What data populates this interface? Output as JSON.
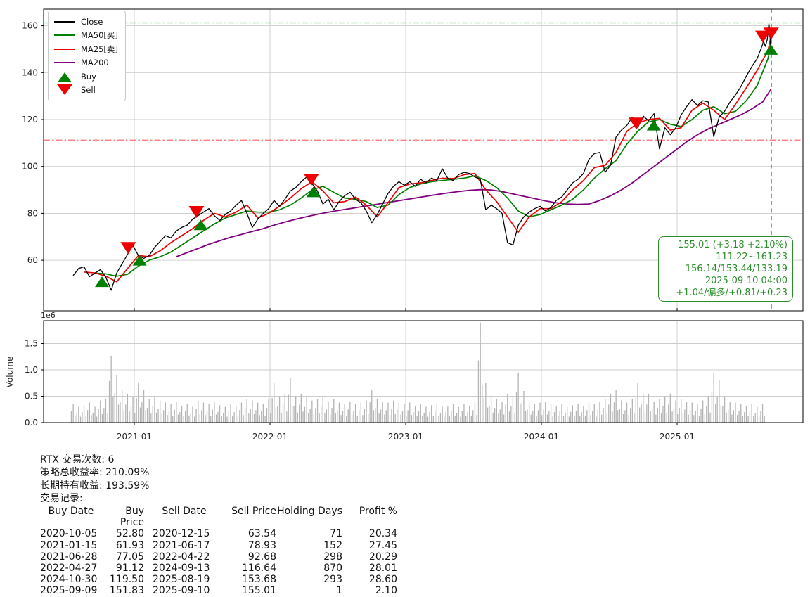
{
  "colors": {
    "close": "#000000",
    "ma25": "#f00000",
    "ma50": "#008000",
    "ma200": "#800080",
    "buy_marker": "#008000",
    "sell_marker": "#ee0000",
    "range_high_line": "#00a000",
    "range_low_line": "#ff5555",
    "vline": "#2aa02a",
    "annotation": "#2a8f2a",
    "grid": "#cccccc",
    "volume_bar": "#b4b4b4",
    "tick_text": "#222222"
  },
  "legend": {
    "items": [
      {
        "label": "Close",
        "swatch": "line",
        "color": "#000000"
      },
      {
        "label": "MA50[买]",
        "swatch": "line",
        "color": "#008000"
      },
      {
        "label": "MA25[卖]",
        "swatch": "line",
        "color": "#f00000"
      },
      {
        "label": "MA200",
        "swatch": "line",
        "color": "#800080"
      },
      {
        "label": "Buy",
        "swatch": "triangle-up",
        "color": "#008000"
      },
      {
        "label": "Sell",
        "swatch": "triangle-down",
        "color": "#f00000"
      }
    ]
  },
  "annotation": {
    "lines": [
      "155.01 (+3.18 +2.10%)",
      "111.22~161.23",
      "156.14/153.44/133.19",
      "2025-09-10 04:00",
      "+1.04/偏多/+0.81/+0.23"
    ]
  },
  "summary": {
    "lines": [
      "RTX 交易次数: 6",
      "策略总收益率: 210.09%",
      "长期持有收益: 193.59%",
      "交易记录:"
    ]
  },
  "trade_table": {
    "headers": [
      "Buy Date",
      "Buy Price",
      "Sell Date",
      "Sell Price",
      "Holding Days",
      "Profit %"
    ],
    "rows": [
      [
        "2020-10-05",
        "52.80",
        "2020-12-15",
        "63.54",
        "71",
        "20.34"
      ],
      [
        "2021-01-15",
        "61.93",
        "2021-06-17",
        "78.93",
        "152",
        "27.45"
      ],
      [
        "2021-06-28",
        "77.05",
        "2022-04-22",
        "92.68",
        "298",
        "20.29"
      ],
      [
        "2022-04-27",
        "91.12",
        "2024-09-13",
        "116.64",
        "870",
        "28.01"
      ],
      [
        "2024-10-30",
        "119.50",
        "2025-08-19",
        "153.68",
        "293",
        "28.60"
      ],
      [
        "2025-09-09",
        "151.83",
        "2025-09-10",
        "155.01",
        "1",
        "2.10"
      ]
    ]
  },
  "chart_data": {
    "type": "line",
    "title": "",
    "xlabel": "",
    "ylabel_volume": "Volume",
    "volume_multiplier_label": "1e6",
    "x_axis": {
      "ticks": [
        {
          "t": 2021.0,
          "label": "2021-01"
        },
        {
          "t": 2022.0,
          "label": "2022-01"
        },
        {
          "t": 2023.0,
          "label": "2023-01"
        },
        {
          "t": 2024.0,
          "label": "2024-01"
        },
        {
          "t": 2025.0,
          "label": "2025-01"
        }
      ],
      "xlim": [
        2020.33,
        2025.92
      ]
    },
    "price_axis": {
      "ticks": [
        60,
        80,
        100,
        120,
        140,
        160
      ],
      "ylim": [
        38.5,
        166.5
      ],
      "range_high": 161.23,
      "range_low": 111.22,
      "last_date_t": 2025.695,
      "grid": true
    },
    "volume_axis": {
      "ticks": [
        0.0,
        0.5,
        1.0,
        1.5
      ],
      "ymax": 1.93,
      "grid": true
    },
    "series": {
      "close": {
        "x0": 2020.55,
        "dx": 0.04,
        "values": [
          53.5,
          56.5,
          57.2,
          53.0,
          54.5,
          56.0,
          52.8,
          47.2,
          54.5,
          58.5,
          62.5,
          66.3,
          62.0,
          60.8,
          62.0,
          65.5,
          68.0,
          70.5,
          69.5,
          72.5,
          74.0,
          75.0,
          77.5,
          79.0,
          80.5,
          82.0,
          79.0,
          77.0,
          79.5,
          81.0,
          83.5,
          85.5,
          80.0,
          74.0,
          77.5,
          80.0,
          82.0,
          85.5,
          83.0,
          86.0,
          89.5,
          91.0,
          93.5,
          95.5,
          92.7,
          89.5,
          84.0,
          86.0,
          81.5,
          85.0,
          87.5,
          89.0,
          86.0,
          84.5,
          81.0,
          76.0,
          79.5,
          84.0,
          88.5,
          91.5,
          93.5,
          92.0,
          93.5,
          91.5,
          94.5,
          93.0,
          95.0,
          94.0,
          99.0,
          95.0,
          94.0,
          96.5,
          97.5,
          97.0,
          95.5,
          94.5,
          81.5,
          83.5,
          82.0,
          80.0,
          67.5,
          66.5,
          75.0,
          78.5,
          80.5,
          82.0,
          83.0,
          81.0,
          82.5,
          85.5,
          87.0,
          90.0,
          93.0,
          94.5,
          97.0,
          103.0,
          105.5,
          106.0,
          97.5,
          100.5,
          112.5,
          115.5,
          117.5,
          121.0,
          116.6,
          121.5,
          119.5,
          122.5,
          107.5,
          116.5,
          113.5,
          116.5,
          122.0,
          125.5,
          128.5,
          126.0,
          128.0,
          127.5,
          112.7,
          121.0,
          123.5,
          127.5,
          130.5,
          134.0,
          138.5,
          142.5,
          146.0,
          152.0
        ],
        "tail": [
          [
            2025.636,
            153.68
          ],
          [
            2025.65,
            151.2
          ],
          [
            2025.664,
            154.0
          ],
          [
            2025.676,
            160.9
          ],
          [
            2025.682,
            158.5
          ],
          [
            2025.688,
            151.83
          ],
          [
            2025.695,
            155.01
          ]
        ]
      },
      "ma25": {
        "x0": 2020.63,
        "dx": 0.08,
        "values": [
          55.0,
          54.6,
          53.2,
          50.8,
          56.5,
          62.0,
          61.5,
          64.0,
          67.5,
          70.5,
          73.5,
          77.0,
          80.0,
          78.5,
          80.5,
          83.5,
          78.0,
          80.0,
          83.0,
          86.5,
          90.5,
          93.5,
          89.5,
          84.5,
          85.0,
          87.0,
          83.5,
          78.5,
          84.5,
          91.0,
          92.5,
          93.0,
          94.0,
          95.0,
          94.8,
          96.5,
          97.0,
          90.0,
          85.0,
          78.5,
          72.0,
          78.5,
          82.0,
          82.0,
          85.0,
          90.0,
          94.0,
          99.5,
          100.5,
          106.0,
          115.0,
          118.5,
          120.0,
          120.5,
          115.5,
          116.5,
          124.0,
          127.0,
          124.0,
          120.0,
          126.5,
          133.5,
          141.0,
          149.5
        ],
        "tail": [
          [
            2025.695,
            156.14
          ]
        ]
      },
      "ma50": {
        "x0": 2020.71,
        "dx": 0.08,
        "values": [
          54.5,
          54.2,
          53.2,
          54.0,
          57.5,
          60.0,
          61.5,
          63.5,
          66.5,
          69.5,
          72.5,
          75.5,
          78.0,
          79.5,
          81.0,
          80.5,
          80.5,
          81.5,
          83.5,
          86.5,
          90.0,
          91.5,
          89.0,
          86.5,
          86.0,
          85.0,
          82.5,
          83.5,
          88.0,
          91.0,
          92.5,
          93.5,
          94.0,
          94.5,
          95.0,
          96.0,
          94.0,
          91.0,
          86.5,
          81.0,
          78.5,
          79.5,
          81.5,
          83.5,
          86.0,
          90.0,
          95.0,
          99.0,
          102.5,
          109.5,
          115.0,
          119.0,
          120.0,
          118.0,
          117.0,
          120.0,
          124.0,
          125.5,
          122.5,
          123.5,
          128.0,
          134.5,
          146.0
        ],
        "tail": [
          [
            2025.695,
            153.44
          ]
        ]
      },
      "ma200": {
        "x0": 2021.31,
        "dx": 0.08,
        "values": [
          61.5,
          63.3,
          65.0,
          66.8,
          68.3,
          69.8,
          71.0,
          72.3,
          73.5,
          75.0,
          76.3,
          77.5,
          78.6,
          79.6,
          80.5,
          81.3,
          82.0,
          82.8,
          83.5,
          84.3,
          85.0,
          85.8,
          86.5,
          87.3,
          88.0,
          88.7,
          89.3,
          89.8,
          90.1,
          90.0,
          89.3,
          88.3,
          87.3,
          86.3,
          85.3,
          84.5,
          84.0,
          83.8,
          84.0,
          85.5,
          87.5,
          90.0,
          93.0,
          96.5,
          100.0,
          103.5,
          107.0,
          110.5,
          113.5,
          116.0,
          118.0,
          120.0,
          122.0,
          124.5,
          127.5
        ],
        "tail": [
          [
            2025.695,
            133.19
          ]
        ]
      },
      "volume": {
        "x0": 2020.55,
        "dx": 0.04,
        "values": [
          0.35,
          0.3,
          0.32,
          0.38,
          0.3,
          0.42,
          0.45,
          1.27,
          0.9,
          0.62,
          0.55,
          0.48,
          0.75,
          0.62,
          0.45,
          0.5,
          0.42,
          0.38,
          0.35,
          0.4,
          0.32,
          0.36,
          0.3,
          0.42,
          0.38,
          0.35,
          0.4,
          0.33,
          0.3,
          0.35,
          0.32,
          0.38,
          0.45,
          0.42,
          0.38,
          0.35,
          0.45,
          0.75,
          0.5,
          0.55,
          0.85,
          0.5,
          0.55,
          0.48,
          0.42,
          0.45,
          0.5,
          0.4,
          0.45,
          0.38,
          0.35,
          0.4,
          0.35,
          0.38,
          0.42,
          0.62,
          0.45,
          0.4,
          0.38,
          0.42,
          0.4,
          0.35,
          0.38,
          0.32,
          0.35,
          0.3,
          0.33,
          0.35,
          0.3,
          0.32,
          0.35,
          0.3,
          0.35,
          0.32,
          0.38,
          1.9,
          0.75,
          0.5,
          0.45,
          0.4,
          0.55,
          0.5,
          0.95,
          0.6,
          0.4,
          0.35,
          0.38,
          0.4,
          0.35,
          0.32,
          0.35,
          0.3,
          0.33,
          0.35,
          0.32,
          0.38,
          0.35,
          0.4,
          0.45,
          0.55,
          0.62,
          0.42,
          0.38,
          0.45,
          0.75,
          0.55,
          0.55,
          0.4,
          0.45,
          0.5,
          0.55,
          0.42,
          0.45,
          0.4,
          0.38,
          0.35,
          0.42,
          0.5,
          0.95,
          0.8,
          0.5,
          0.4,
          0.38,
          0.35,
          0.32,
          0.35,
          0.3,
          0.35
        ]
      }
    },
    "markers": {
      "buys": [
        {
          "t": 2020.762,
          "price": 52.8
        },
        {
          "t": 2021.04,
          "price": 61.93
        },
        {
          "t": 2021.49,
          "price": 77.05
        },
        {
          "t": 2022.32,
          "price": 91.12
        },
        {
          "t": 2024.828,
          "price": 119.5
        },
        {
          "t": 2025.691,
          "price": 151.83
        }
      ],
      "sells": [
        {
          "t": 2020.955,
          "price": 63.54
        },
        {
          "t": 2021.458,
          "price": 78.93
        },
        {
          "t": 2022.305,
          "price": 92.68
        },
        {
          "t": 2024.7,
          "price": 116.64
        },
        {
          "t": 2025.632,
          "price": 153.68
        },
        {
          "t": 2025.693,
          "price": 155.01
        }
      ]
    }
  }
}
